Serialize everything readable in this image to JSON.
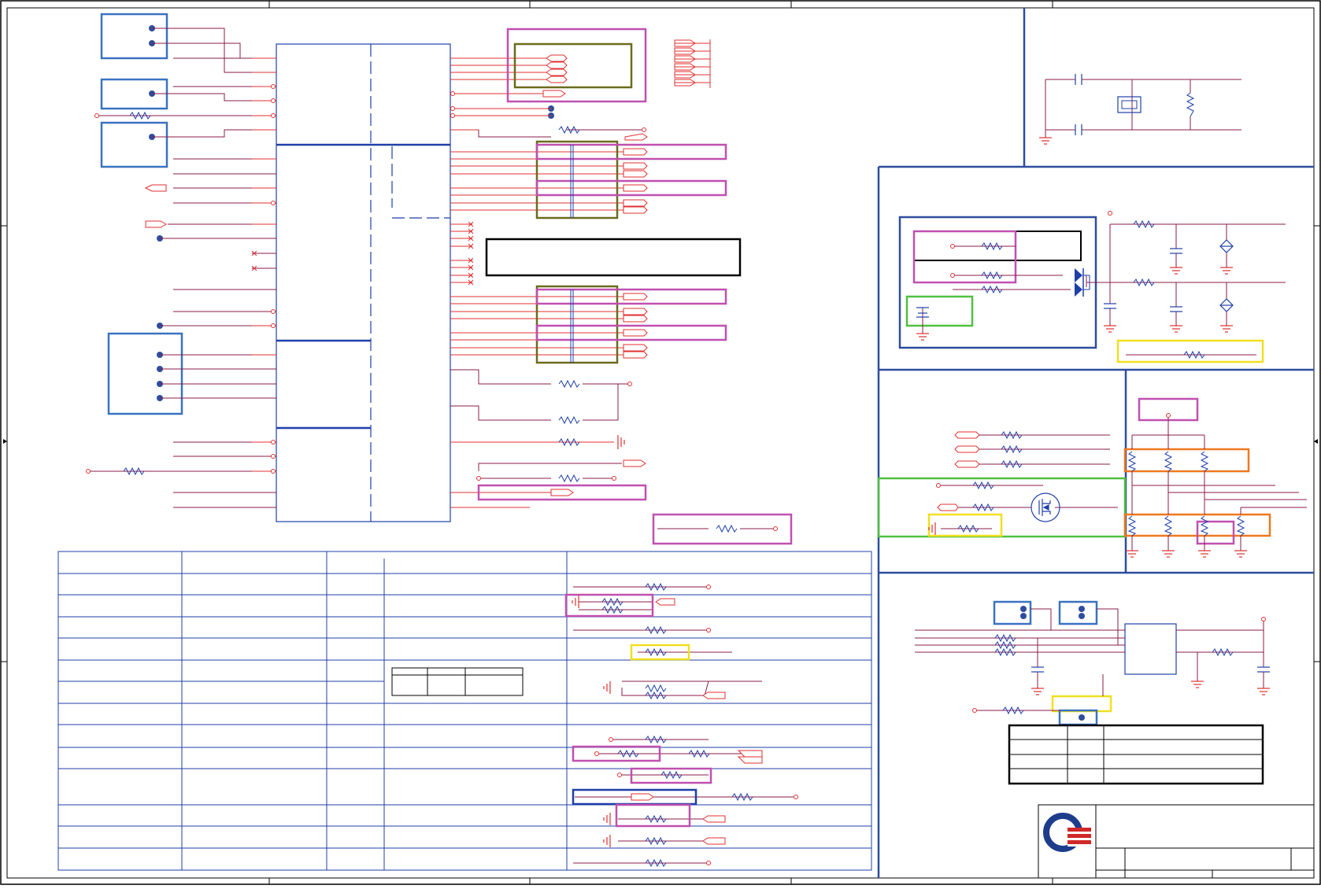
{
  "sheet": {
    "title": "",
    "text_labels": [],
    "colors": {
      "background": "#ffffff",
      "border": "#000000",
      "frame_blue": "#2e4d9e",
      "wire": "#8a1c4a",
      "wire_red": "#e03030",
      "component_blue": "#1f3fa8",
      "connector_blue": "#3a72c0",
      "highlight_magenta": "#c050b0",
      "highlight_olive": "#6b6b1e",
      "highlight_yellow": "#f0e020",
      "highlight_green": "#50c040",
      "highlight_orange": "#f07820",
      "logo_blue": "#1e3c8c",
      "logo_red": "#d02828"
    }
  },
  "icons": {
    "resistor": "resistor-icon",
    "capacitor": "capacitor-icon",
    "ground": "ground-icon",
    "crystal": "crystal-icon",
    "diode": "diode-icon",
    "transistor": "mosfet-icon",
    "connector_pin": "connector-pin-icon",
    "off_page": "off-page-connector-icon",
    "logo": "company-logo-icon"
  }
}
